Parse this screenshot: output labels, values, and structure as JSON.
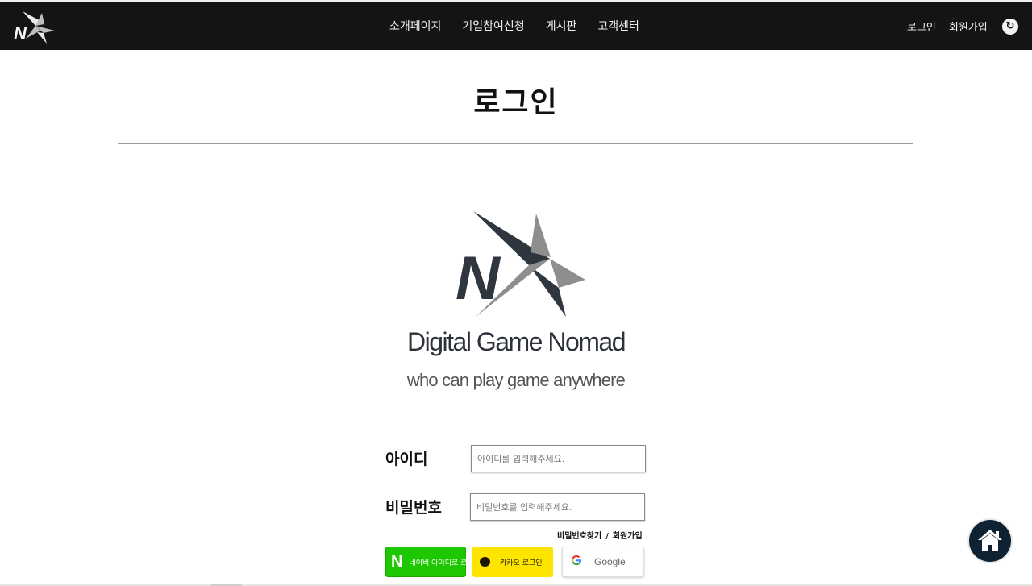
{
  "header": {
    "nav": [
      "소개페이지",
      "기업참여신청",
      "게시판",
      "고객센터"
    ],
    "auth": {
      "login": "로그인",
      "signup": "회원가입"
    },
    "refresh_icon": "↻"
  },
  "page": {
    "title": "로그인"
  },
  "brand": {
    "name": "Digital Game Nomad",
    "tagline": "who can play game anywhere",
    "logo_letter": "N",
    "colors": {
      "dark": "#2f3640",
      "gray": "#8e8e8e"
    }
  },
  "form": {
    "id_label": "아이디",
    "id_placeholder": "아이디를 입력해주세요.",
    "pw_label": "비밀번호",
    "pw_placeholder": "비밀번호를 입력해주세요.",
    "find_password": "비밀번호찾기",
    "separator": "/",
    "signup": "회원가입"
  },
  "social": {
    "naver": {
      "mark": "N",
      "label": "네이버 아이디로 로그인",
      "color": "#1ec800"
    },
    "kakao": {
      "label": "카카오 로그인",
      "color": "#fee500"
    },
    "google": {
      "mark": "G",
      "label": "Google"
    }
  },
  "icons": {
    "home": "home-icon",
    "refresh": "refresh-icon",
    "kakao": "speech-bubble-icon",
    "google": "google-g-icon"
  }
}
